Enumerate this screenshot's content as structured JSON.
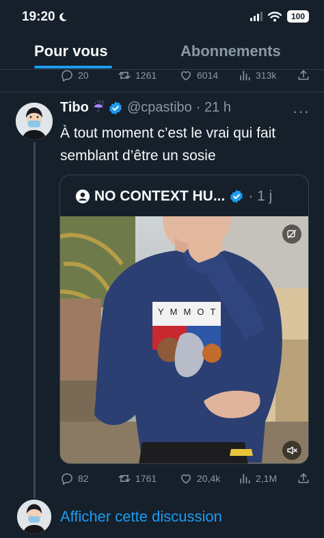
{
  "status_bar": {
    "time": "19:20",
    "battery": "100"
  },
  "tabs": {
    "active": "Pour vous",
    "inactive": "Abonnements"
  },
  "prev_tweet_actions": {
    "replies": "20",
    "retweets": "1261",
    "likes": "6014",
    "views": "313k"
  },
  "tweet": {
    "name": "Tibo",
    "emoji": "☔",
    "handle": "@cpastibo",
    "time": "· 21 h",
    "text": "À tout moment c’est le vrai qui fait semblant d’être un sosie",
    "more": "···"
  },
  "quote": {
    "name": "NO CONTEXT HU...",
    "time": "· 1 j",
    "shirt_text": "YMMOT"
  },
  "tweet_actions": {
    "replies": "82",
    "retweets": "1761",
    "likes": "20,4k",
    "views": "2,1M"
  },
  "thread": {
    "show_label": "Afficher cette discussion"
  },
  "colors": {
    "background": "#15202b",
    "accent": "#1d9bf0",
    "muted": "#8b98a5"
  }
}
